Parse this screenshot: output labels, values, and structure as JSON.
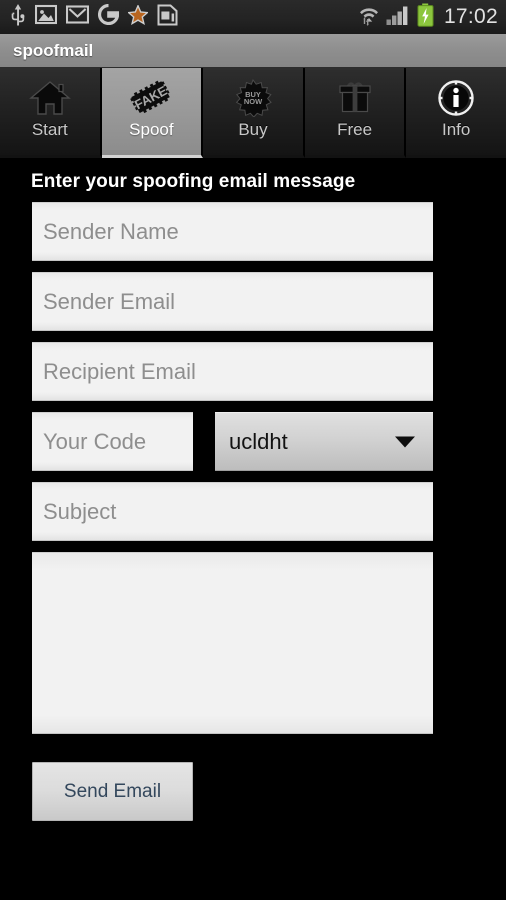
{
  "statusbar": {
    "left_icons": [
      {
        "name": "usb-icon",
        "label": "USB"
      },
      {
        "name": "gallery-image-icon",
        "label": "Gallery"
      },
      {
        "name": "gmail-icon",
        "label": "Gmail"
      },
      {
        "name": "google-icon",
        "label": "Google"
      },
      {
        "name": "star-icon",
        "label": "Star"
      },
      {
        "name": "sim-card-icon",
        "label": "SIM card"
      }
    ],
    "right_icons": [
      {
        "name": "wifi-icon",
        "label": "Wi-Fi"
      },
      {
        "name": "signal-bars-icon",
        "label": "Signal"
      },
      {
        "name": "battery-charging-icon",
        "label": "Battery charging"
      }
    ],
    "clock": "17:02",
    "battery_color": "#8cc63e"
  },
  "titlebar": {
    "app_title": "spoofmail"
  },
  "tabs": [
    {
      "id": "start",
      "label": "Start",
      "icon": "home-icon",
      "selected": false
    },
    {
      "id": "spoof",
      "label": "Spoof",
      "icon": "fake-stamp-icon",
      "selected": true
    },
    {
      "id": "buy",
      "label": "Buy",
      "icon": "buy-now-badge-icon",
      "selected": false
    },
    {
      "id": "free",
      "label": "Free",
      "icon": "gift-box-icon",
      "selected": false
    },
    {
      "id": "info",
      "label": "Info",
      "icon": "info-circle-icon",
      "selected": false
    }
  ],
  "form": {
    "heading": "Enter your spoofing email message",
    "sender_name": {
      "value": "",
      "placeholder": "Sender Name"
    },
    "sender_email": {
      "value": "",
      "placeholder": "Sender Email"
    },
    "recipient_email": {
      "value": "",
      "placeholder": "Recipient Email"
    },
    "your_code": {
      "value": "",
      "placeholder": "Your Code"
    },
    "code_spinner": {
      "selected": "ucldht"
    },
    "subject": {
      "value": "",
      "placeholder": "Subject"
    },
    "message": {
      "value": "",
      "placeholder": ""
    },
    "send_button": "Send Email"
  }
}
